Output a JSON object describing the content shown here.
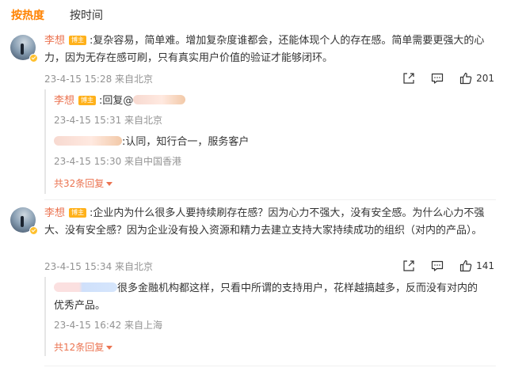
{
  "tabs": [
    {
      "label": "按热度"
    },
    {
      "label": "按时间"
    }
  ],
  "comments": [
    {
      "author": "李想",
      "badge": "博主",
      "text": ":复杂容易，简单难。增加复杂度谁都会，还能体现个人的存在感。简单需要更强大的心力，因为无存在感可刷，只有真实用户价值的验证才能够闭环。",
      "meta": "23-4-15 15:28 来自北京",
      "likes": "201",
      "replies": [
        {
          "author": "李想",
          "badge": "博主",
          "text": ":回复@",
          "meta": "23-4-15 15:31 来自北京"
        },
        {
          "text": ":认同，知行合一，服务客户",
          "meta": "23-4-15 15:30 来自中国香港"
        }
      ],
      "more_label": "共32条回复"
    },
    {
      "author": "李想",
      "badge": "博主",
      "text": ":企业内为什么很多人要持续刷存在感？因为心力不强大，没有安全感。为什么心力不强大、没有安全感？因为企业没有投入资源和精力去建立支持大家持续成功的组织（对内的产品）。",
      "meta": "23-4-15 15:34 来自北京",
      "likes": "141",
      "replies": [
        {
          "text": "很多金融机构都这样，只看中所谓的支持用户，花样越搞越多，反而没有对内的优秀产品。",
          "meta": "23-4-15 16:42 来自上海"
        }
      ],
      "more_label": "共12条回复"
    }
  ]
}
